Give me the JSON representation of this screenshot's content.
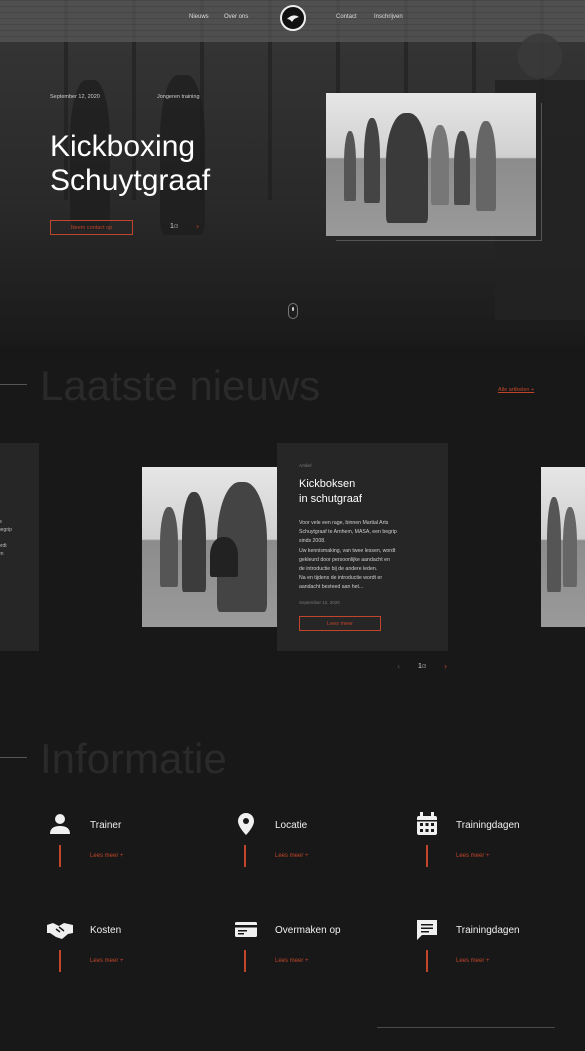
{
  "nav": {
    "items": [
      "Nieuws",
      "Over ons",
      "Contact",
      "Inschrijven"
    ]
  },
  "hero": {
    "date": "September 12, 2020",
    "category": "Jongeren training",
    "title_line1": "Kickboxing",
    "title_line2": "Schuytgraaf",
    "button": "Neem contact op",
    "counter_current": "1",
    "counter_total": "/3",
    "next_icon": "chevron-right-icon"
  },
  "news": {
    "section_title": "Laatste nieuws",
    "all_link": "Alle artikelen +",
    "left_card_fragments": [
      "ts",
      "begrip",
      "",
      "ordt",
      "en"
    ],
    "card": {
      "category": "Artikel",
      "title_line1": "Kickboksen",
      "title_line2": "in schutgraaf",
      "excerpt_lines": [
        "Voor vele een rage, binnen Martial Arts",
        "Schuytgraaf  te Arnhem, MASA, een begrip",
        "sinds 2008.",
        "Uw kennismaking, van twee lessen, wordt",
        "gekleurd door persoonlijke aandacht en",
        "de introductie bij de andere leden.",
        "Na en tijdens de introductie wordt er",
        "aandacht besteed aan het..."
      ],
      "date": "September 12, 2020",
      "button": "Lees meer"
    },
    "slider_current": "1",
    "slider_total": "/3"
  },
  "info": {
    "section_title": "Informatie",
    "items": [
      {
        "icon": "person-icon",
        "label": "Trainer",
        "more": "Lees meer +"
      },
      {
        "icon": "location-pin-icon",
        "label": "Locatie",
        "more": "Lees meer +"
      },
      {
        "icon": "calendar-icon",
        "label": "Trainingdagen",
        "more": "Lees meer +"
      },
      {
        "icon": "handshake-icon",
        "label": "Kosten",
        "more": "Lees meer +"
      },
      {
        "icon": "payment-card-icon",
        "label": "Overmaken op",
        "more": "Lees meer +"
      },
      {
        "icon": "chat-icon",
        "label": "Trainingdagen",
        "more": "Lees meer +"
      }
    ]
  },
  "colors": {
    "accent": "#c0452a",
    "background": "#181818",
    "card": "#262626"
  }
}
